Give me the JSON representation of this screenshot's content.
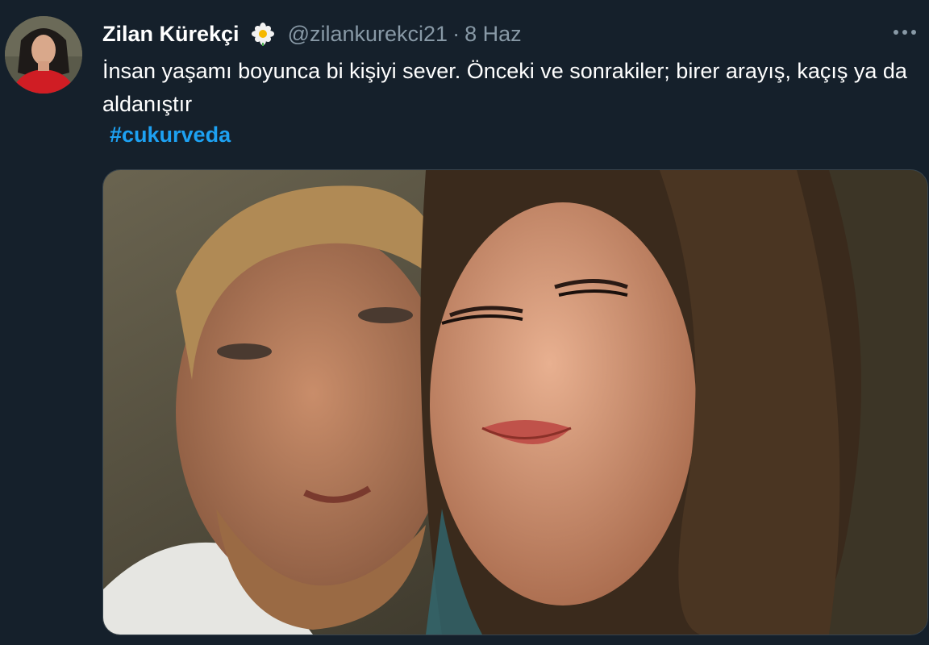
{
  "tweet": {
    "author": {
      "display_name": "Zilan Kürekçi",
      "badge_icon": "flower-icon",
      "handle": "@zilankurekci21",
      "separator": "·",
      "date": "8 Haz"
    },
    "text": "İnsan yaşamı boyunca bi kişiyi sever. Önceki ve sonrakiler; birer arayış, kaçış ya da aldanıştır",
    "hashtag": "#cukurveda",
    "more_icon": "more-icon"
  },
  "colors": {
    "background": "#15202b",
    "text": "#ffffff",
    "muted": "#8899a6",
    "link": "#1da1f2"
  }
}
